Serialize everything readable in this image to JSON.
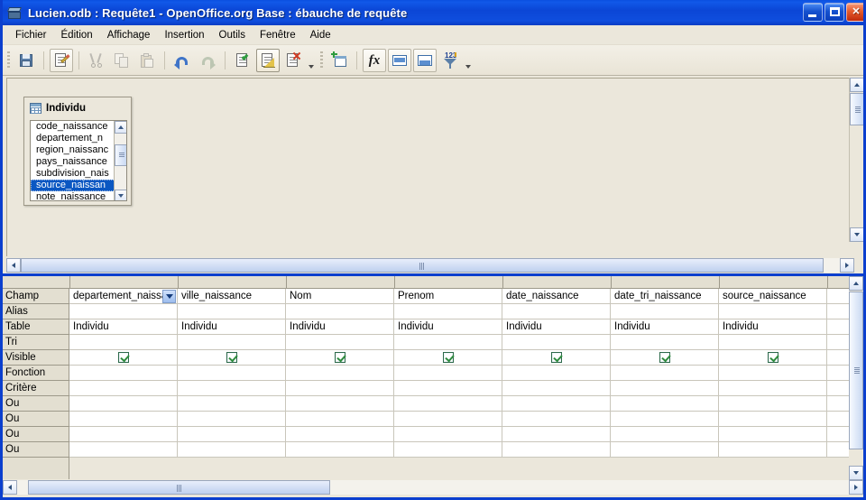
{
  "window": {
    "title": "Lucien.odb : Requête1 - OpenOffice.org Base : ébauche de requête",
    "app_icon": "base-document-icon",
    "minimize_label": "",
    "maximize_label": "",
    "close_label": "✕"
  },
  "menubar": {
    "items": [
      {
        "label": "Fichier",
        "name": "menu-fichier"
      },
      {
        "label": "Édition",
        "name": "menu-edition"
      },
      {
        "label": "Affichage",
        "name": "menu-affichage"
      },
      {
        "label": "Insertion",
        "name": "menu-insertion"
      },
      {
        "label": "Outils",
        "name": "menu-outils"
      },
      {
        "label": "Fenêtre",
        "name": "menu-fenetre"
      },
      {
        "label": "Aide",
        "name": "menu-aide"
      }
    ]
  },
  "toolbar": {
    "buttons": [
      {
        "name": "save-icon",
        "label": "Enregistrer"
      },
      {
        "name": "edit-mode-icon",
        "label": "Édition"
      },
      {
        "name": "cut-icon",
        "label": "Couper"
      },
      {
        "name": "copy-icon",
        "label": "Copier"
      },
      {
        "name": "paste-icon",
        "label": "Coller"
      },
      {
        "name": "undo-icon",
        "label": "Annuler"
      },
      {
        "name": "redo-icon",
        "label": "Rétablir"
      },
      {
        "name": "run-query-icon",
        "label": "Exécuter la requête"
      },
      {
        "name": "design-view-icon",
        "label": "Activer/désactiver l'ébauche"
      },
      {
        "name": "clear-query-icon",
        "label": "Effacer la requête"
      },
      {
        "name": "add-table-icon",
        "label": "Ajouter une table"
      },
      {
        "name": "functions-icon",
        "label": "Fonctions"
      },
      {
        "name": "table-name-icon",
        "label": "Nom de table"
      },
      {
        "name": "alias-icon",
        "label": "Alias"
      },
      {
        "name": "distinct-values-icon",
        "label": "Valeurs distinctes"
      }
    ]
  },
  "table_window": {
    "title": "Individu",
    "icon": "table-icon",
    "fields": [
      {
        "label": "code_naissance",
        "selected": false
      },
      {
        "label": "departement_n",
        "selected": false
      },
      {
        "label": "region_naissanc",
        "selected": false
      },
      {
        "label": "pays_naissance",
        "selected": false
      },
      {
        "label": "subdivision_nais",
        "selected": false
      },
      {
        "label": "source_naissan",
        "selected": true
      },
      {
        "label": "note_naissance",
        "selected": false
      }
    ]
  },
  "query_grid": {
    "row_labels": [
      "Champ",
      "Alias",
      "Table",
      "Tri",
      "Visible",
      "Fonction",
      "Critère",
      "Ou",
      "Ou",
      "Ou",
      "Ou"
    ],
    "columns": [
      {
        "champ": "departement_naissa",
        "alias": "",
        "table": "Individu",
        "tri": "",
        "visible": true,
        "fonction": "",
        "critere": "",
        "ou": [
          "",
          "",
          "",
          ""
        ],
        "has_dropdown": true
      },
      {
        "champ": "ville_naissance",
        "alias": "",
        "table": "Individu",
        "tri": "",
        "visible": true,
        "fonction": "",
        "critere": "",
        "ou": [
          "",
          "",
          "",
          ""
        ],
        "has_dropdown": false
      },
      {
        "champ": "Nom",
        "alias": "",
        "table": "Individu",
        "tri": "",
        "visible": true,
        "fonction": "",
        "critere": "",
        "ou": [
          "",
          "",
          "",
          ""
        ],
        "has_dropdown": false
      },
      {
        "champ": "Prenom",
        "alias": "",
        "table": "Individu",
        "tri": "",
        "visible": true,
        "fonction": "",
        "critere": "",
        "ou": [
          "",
          "",
          "",
          ""
        ],
        "has_dropdown": false
      },
      {
        "champ": "date_naissance",
        "alias": "",
        "table": "Individu",
        "tri": "",
        "visible": true,
        "fonction": "",
        "critere": "",
        "ou": [
          "",
          "",
          "",
          ""
        ],
        "has_dropdown": false
      },
      {
        "champ": "date_tri_naissance",
        "alias": "",
        "table": "Individu",
        "tri": "",
        "visible": true,
        "fonction": "",
        "critere": "",
        "ou": [
          "",
          "",
          "",
          ""
        ],
        "has_dropdown": false
      },
      {
        "champ": "source_naissance",
        "alias": "",
        "table": "Individu",
        "tri": "",
        "visible": true,
        "fonction": "",
        "critere": "",
        "ou": [
          "",
          "",
          "",
          ""
        ],
        "has_dropdown": false
      },
      {
        "champ": "",
        "alias": "",
        "table": "",
        "tri": "",
        "visible": false,
        "fonction": "",
        "critere": "",
        "ou": [
          "",
          "",
          "",
          ""
        ],
        "has_dropdown": false
      }
    ]
  },
  "colors": {
    "titlebar_blue": "#0b46d6",
    "window_border": "#0b3fce",
    "face": "#ebe7db",
    "header_face": "#e3dfd1",
    "selection_blue": "#0a57c2",
    "check_green": "#2e8b3e",
    "scroll_thumb": "#bfd1ef"
  }
}
